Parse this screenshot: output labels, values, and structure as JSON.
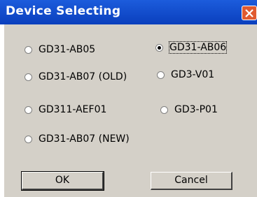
{
  "window": {
    "title": "Device Selecting"
  },
  "options": [
    {
      "label": "GD31-AB05",
      "checked": false
    },
    {
      "label": "GD31-AB06",
      "checked": true
    },
    {
      "label": "GD31-AB07 (OLD)",
      "checked": false
    },
    {
      "label": "GD3-V01",
      "checked": false
    },
    {
      "label": "GD311-AEF01",
      "checked": false
    },
    {
      "label": "GD3-P01",
      "checked": false
    },
    {
      "label": "GD31-AB07 (NEW)",
      "checked": false
    }
  ],
  "buttons": {
    "ok_label": "OK",
    "cancel_label": "Cancel"
  },
  "colors": {
    "titlebar": "#0a3fbd",
    "dialog_bg": "#d4d0c8",
    "close_button": "#e05a30"
  }
}
